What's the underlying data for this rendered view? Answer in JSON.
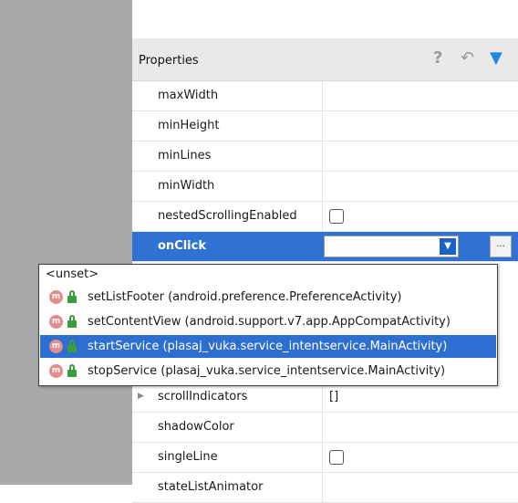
{
  "panel": {
    "title": "Properties",
    "icons": {
      "help": "?",
      "undo": "↶",
      "filter": "▼"
    }
  },
  "rows": [
    {
      "name": "maxWidth"
    },
    {
      "name": "minHeight"
    },
    {
      "name": "minLines"
    },
    {
      "name": "minWidth"
    },
    {
      "name": "nestedScrollingEnabled"
    },
    {
      "name": "onClick",
      "combo_value": "",
      "combo_arrow": "▼",
      "ellipsis": "..."
    },
    {
      "name": "scrollIndicators",
      "value": "[]"
    },
    {
      "name": "shadowColor"
    },
    {
      "name": "singleLine"
    },
    {
      "name": "stateListAnimator"
    }
  ],
  "popup": {
    "unset_label": "<unset>",
    "method_icon": "m",
    "items": [
      {
        "label": "setListFooter (android.preference.PreferenceActivity)"
      },
      {
        "label": "setContentView (android.support.v7.app.AppCompatActivity)"
      },
      {
        "label": "startService (plasaj_vuka.service_intentservice.MainActivity)"
      },
      {
        "label": "stopService (plasaj_vuka.service_intentservice.MainActivity)"
      }
    ]
  },
  "colors": {
    "selection": "#3072d1",
    "filter_icon": "#1e88e5",
    "method_icon": "#e48b8b",
    "lock_icon": "#3c9b3c"
  }
}
